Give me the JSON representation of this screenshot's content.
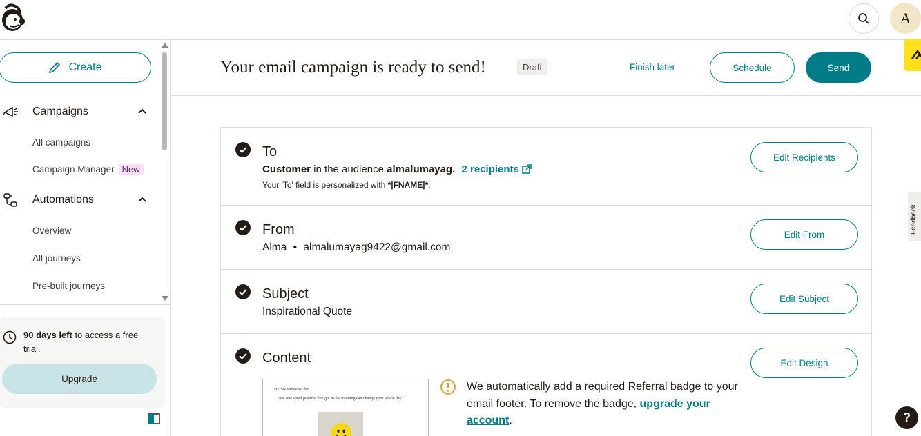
{
  "topbar": {
    "avatar_initial": "A"
  },
  "sidebar": {
    "create_label": "Create",
    "sections": [
      {
        "label": "Campaigns",
        "items": [
          "All campaigns",
          "Campaign Manager"
        ],
        "badge": "New"
      },
      {
        "label": "Automations",
        "items": [
          "Overview",
          "All journeys",
          "Pre-built journeys"
        ]
      }
    ],
    "trial": {
      "days_bold": "90 days left",
      "rest": " to access a free trial.",
      "upgrade_label": "Upgrade"
    }
  },
  "header": {
    "title": "Your email campaign is ready to send!",
    "status_badge": "Draft",
    "finish_later": "Finish later",
    "schedule": "Schedule",
    "send": "Send"
  },
  "checklist": {
    "to": {
      "title": "To",
      "recipient_segment": "Customer",
      "in_the_audience": " in the audience ",
      "audience_name": "almalumayag.",
      "recipients_link": "2 recipients",
      "personalized_prefix": "Your 'To' field is personalized with ",
      "merge_tag": "*|FNAME|*",
      "personalized_suffix": ".",
      "edit_label": "Edit Recipients"
    },
    "from": {
      "title": "From",
      "name": "Alma",
      "separator": "•",
      "email": "almalumayag9422@gmail.com",
      "edit_label": "Edit From"
    },
    "subject": {
      "title": "Subject",
      "value": "Inspirational Quote",
      "edit_label": "Edit Subject"
    },
    "content": {
      "title": "Content",
      "edit_label": "Edit Design",
      "preview_line1": "Hi! Sis reminded that",
      "preview_line2": "\"Just one small positive thought in the morning can change your whole day.\"",
      "notice_text": "We automatically add a required Referral badge to your email footer. To remove the badge,",
      "notice_link": "upgrade your account",
      "notice_end": "."
    }
  },
  "misc": {
    "feedback_label": "Feedback",
    "help_label": "?"
  },
  "colors": {
    "accent": "#007c89",
    "dark": "#241c15",
    "yellow": "#ffe01b",
    "upgrade_bg": "#c8e4e6"
  }
}
